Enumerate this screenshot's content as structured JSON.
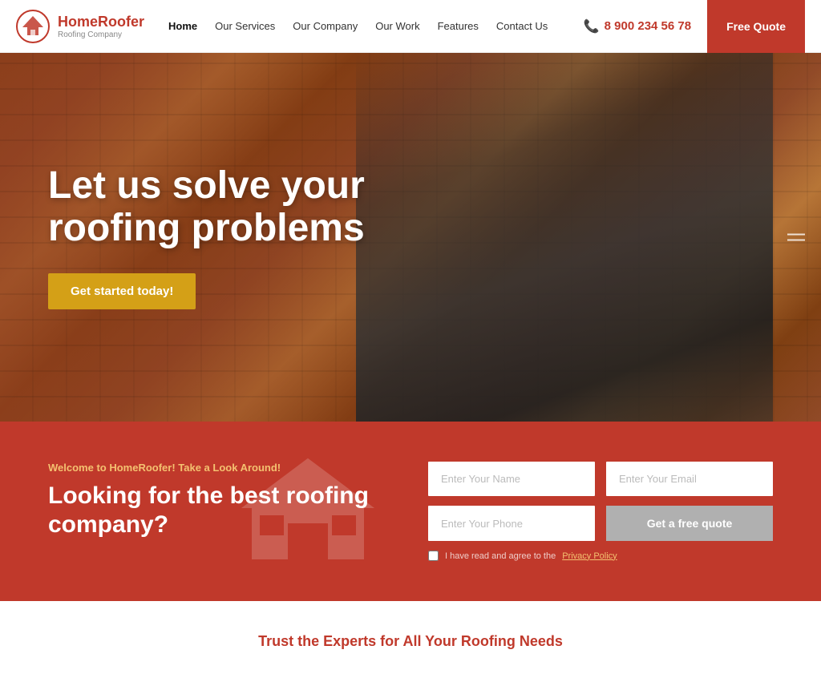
{
  "header": {
    "logo_title": "HomeRoofer",
    "logo_subtitle": "Roofing Company",
    "nav": [
      {
        "label": "Home",
        "active": true
      },
      {
        "label": "Our Services",
        "active": false
      },
      {
        "label": "Our Company",
        "active": false
      },
      {
        "label": "Our Work",
        "active": false
      },
      {
        "label": "Features",
        "active": false
      },
      {
        "label": "Contact Us",
        "active": false
      }
    ],
    "phone": "8 900 234 56 78",
    "cta_label": "Free Quote"
  },
  "hero": {
    "title": "Let us solve your roofing problems",
    "cta_label": "Get started today!"
  },
  "orange_section": {
    "welcome_text": "Welcome to HomeRoofer! Take a Look Around!",
    "heading": "Looking for the best roofing company?",
    "form": {
      "name_placeholder": "Enter Your Name",
      "email_placeholder": "Enter Your Email",
      "phone_placeholder": "Enter Your Phone",
      "quote_btn": "Get a free quote",
      "checkbox_label": "I have read and agree to the",
      "privacy_link": "Privacy Policy"
    }
  },
  "bottom": {
    "tagline": "Trust the Experts for All Your Roofing Needs"
  }
}
